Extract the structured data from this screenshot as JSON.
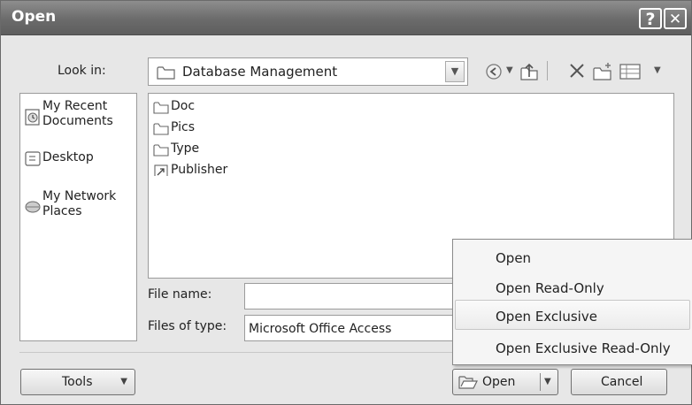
{
  "window": {
    "title": "Open",
    "help_glyph": "?",
    "close_glyph": "✕"
  },
  "look_in": {
    "label": "Look in:",
    "value": "Database Management"
  },
  "places": [
    {
      "label": "My Recent Documents",
      "icon": "recent-documents-icon"
    },
    {
      "label": "Desktop",
      "icon": "desktop-icon"
    },
    {
      "label": "My Network Places",
      "icon": "network-places-icon"
    }
  ],
  "files": [
    {
      "name": "Doc",
      "icon": "folder-icon"
    },
    {
      "name": "Pics",
      "icon": "folder-icon"
    },
    {
      "name": "Type",
      "icon": "folder-icon"
    },
    {
      "name": "Publisher",
      "icon": "shortcut-icon"
    }
  ],
  "file_name": {
    "label": "File name:",
    "value": ""
  },
  "file_type": {
    "label": "Files of type:",
    "value": "Microsoft Office Access"
  },
  "buttons": {
    "tools": "Tools",
    "open": "Open",
    "cancel": "Cancel"
  },
  "open_menu": {
    "items": [
      "Open",
      "Open Read-Only",
      "Open Exclusive",
      "Open Exclusive Read-Only"
    ],
    "highlighted": "Open Exclusive"
  }
}
